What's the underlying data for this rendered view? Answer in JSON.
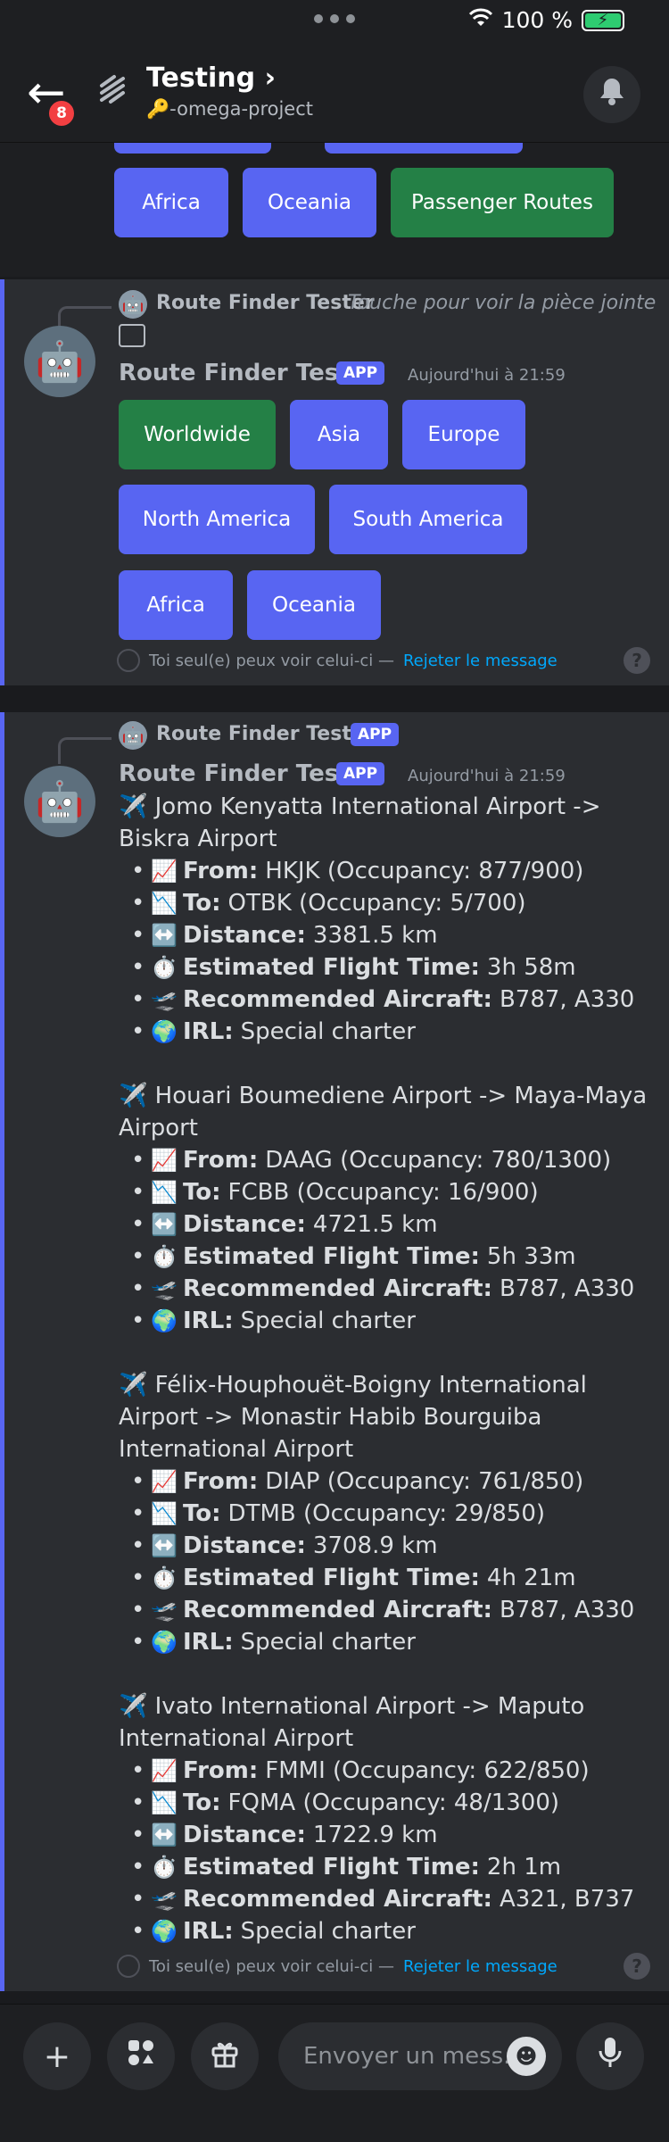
{
  "status": {
    "battery_text": "100 %"
  },
  "header": {
    "back_badge": "8",
    "title": "Testing",
    "title_chevron": "›",
    "subtitle": "🔑-omega-project",
    "icons": {
      "back": "arrow-left-icon",
      "thread": "thread-icon",
      "bell": "bell-icon"
    }
  },
  "top_buttons": [
    {
      "label": "Africa",
      "style": "blurple"
    },
    {
      "label": "Oceania",
      "style": "blurple"
    },
    {
      "label": "Passenger Routes",
      "style": "green"
    }
  ],
  "message1": {
    "reply_author": "Route Finder Tester",
    "reply_hint": "Touche pour voir la pièce jointe",
    "author": "Route Finder Tester",
    "app_tag": "APP",
    "timestamp": "Aujourd'hui à 21:59",
    "buttons": [
      {
        "label": "Worldwide",
        "style": "green"
      },
      {
        "label": "Asia",
        "style": "blurple"
      },
      {
        "label": "Europe",
        "style": "blurple"
      },
      {
        "label": "North America",
        "style": "blurple"
      },
      {
        "label": "South America",
        "style": "blurple"
      },
      {
        "label": "Africa",
        "style": "blurple"
      },
      {
        "label": "Oceania",
        "style": "blurple"
      }
    ],
    "ephemeral_text": "Toi seul(e) peux voir celui-ci —",
    "dismiss_link": "Rejeter le message"
  },
  "message2": {
    "reply_author": "Route Finder Tester",
    "reply_app_tag": "APP",
    "author": "Route Finder Tester",
    "app_tag": "APP",
    "timestamp": "Aujourd'hui à 21:59",
    "labels": {
      "from": "From:",
      "to": "To:",
      "distance": "Distance:",
      "time": "Estimated Flight Time:",
      "aircraft": "Recommended Aircraft:",
      "irl": "IRL:"
    },
    "routes": [
      {
        "title": "✈️ Jomo Kenyatta International Airport -> Biskra Airport",
        "from": "HKJK (Occupancy: 877/900)",
        "to": "OTBK (Occupancy: 5/700)",
        "distance": "3381.5 km",
        "time": "3h 58m",
        "aircraft": "B787, A330",
        "irl": "Special charter"
      },
      {
        "title": "✈️ Houari Boumediene Airport -> Maya-Maya Airport",
        "from": "DAAG (Occupancy: 780/1300)",
        "to": "FCBB (Occupancy: 16/900)",
        "distance": "4721.5 km",
        "time": "5h 33m",
        "aircraft": "B787, A330",
        "irl": "Special charter"
      },
      {
        "title": "✈️ Félix-Houphouët-Boigny International Airport -> Monastir Habib Bourguiba International Airport",
        "from": "DIAP (Occupancy: 761/850)",
        "to": "DTMB (Occupancy: 29/850)",
        "distance": "3708.9 km",
        "time": "4h 21m",
        "aircraft": "B787, A330",
        "irl": "Special charter"
      },
      {
        "title": "✈️ Ivato International Airport -> Maputo International Airport",
        "from": "FMMI (Occupancy: 622/850)",
        "to": "FQMA (Occupancy: 48/1300)",
        "distance": "1722.9 km",
        "time": "2h 1m",
        "aircraft": "A321, B737",
        "irl": "Special charter"
      }
    ],
    "ephemeral_text": "Toi seul(e) peux voir celui-ci —",
    "dismiss_link": "Rejeter le message"
  },
  "composer": {
    "placeholder": "Envoyer un mess...",
    "icons": [
      "plus-icon",
      "apps-icon",
      "gift-icon",
      "emoji-icon",
      "microphone-icon"
    ]
  },
  "colors": {
    "blurple": "#5865f2",
    "green": "#248046",
    "link": "#00a8fc",
    "badge": "#f23f42"
  }
}
